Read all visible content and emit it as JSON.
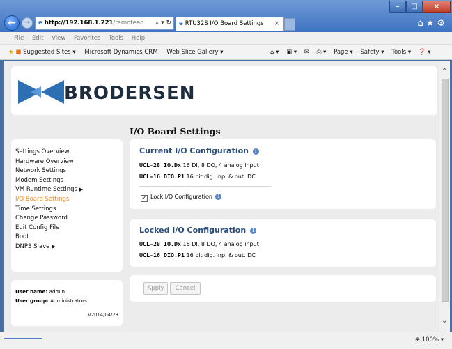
{
  "browser": {
    "address_host": "http://192.168.1.221",
    "address_path": "/remotead",
    "address_tools": "⌕ ▾ ↻",
    "tab_title": "RTU32S I/O Board Settings",
    "tab_close": "×",
    "top_icons": "⌂★⚙",
    "window_buttons": {
      "minimize": "–",
      "maximize": "□",
      "close": "×"
    },
    "menu": [
      "File",
      "Edit",
      "View",
      "Favorites",
      "Tools",
      "Help"
    ],
    "favorites": [
      "Suggested Sites ▾",
      "Microsoft Dynamics CRM",
      "Web Slice Gallery ▾"
    ],
    "toolbar_right": [
      "⌂ ▾",
      "▣ ▾",
      "✉",
      "⎙ ▾",
      "Page ▾",
      "Safety ▾",
      "Tools ▾",
      "❓ ▾"
    ],
    "zoom": "⊕ 100%  ▾"
  },
  "header": {
    "logo_text": "BRODERSEN"
  },
  "page_title": "I/O Board Settings",
  "sidebar": {
    "items": [
      {
        "label": "Settings Overview",
        "arrow": ""
      },
      {
        "label": "Hardware Overview",
        "arrow": ""
      },
      {
        "label": "Network Settings",
        "arrow": ""
      },
      {
        "label": "Modem Settings",
        "arrow": ""
      },
      {
        "label": "VM Runtime Settings",
        "arrow": "▶"
      },
      {
        "label": "I/O Board Settings",
        "arrow": ""
      },
      {
        "label": "Time Settings",
        "arrow": ""
      },
      {
        "label": "Change Password",
        "arrow": ""
      },
      {
        "label": "Edit Config File",
        "arrow": ""
      },
      {
        "label": "Boot",
        "arrow": ""
      },
      {
        "label": "DNP3 Slave",
        "arrow": "▶"
      }
    ],
    "active_index": 5
  },
  "user": {
    "name_label": "User name:",
    "name_value": " admin",
    "group_label": "User group:",
    "group_value": " Administrators",
    "version": "V2014/04/23"
  },
  "current_config": {
    "title": "Current I/O Configuration",
    "rows": [
      {
        "model": "UCL-28 IO.Dx",
        "desc": "  16 DI, 8 DO, 4 analog input"
      },
      {
        "model": "UCL-16 DIO.P1",
        "desc": " 16 bit dig. inp. & out. DC"
      }
    ],
    "lock_label": "Lock I/O Configuration",
    "lock_checked": "✓"
  },
  "locked_config": {
    "title": "Locked I/O Configuration",
    "rows": [
      {
        "model": "UCL-28 IO.Dx",
        "desc": "  16 DI, 8 DO, 4 analog input"
      },
      {
        "model": "UCL-16 DIO.P1",
        "desc": " 16 bit dig. inp. & out. DC"
      }
    ]
  },
  "actions": {
    "apply": "Apply",
    "cancel": "Cancel"
  },
  "info_glyph": "i"
}
